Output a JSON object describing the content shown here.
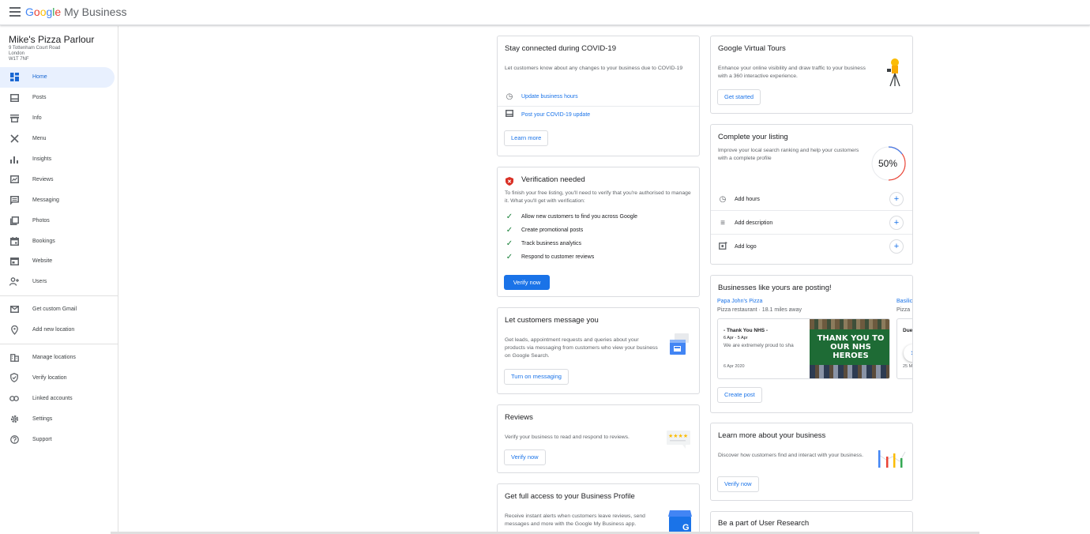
{
  "app": {
    "brand_google": "Google",
    "brand_rest": "My Business"
  },
  "business": {
    "name": "Mike's Pizza Parlour",
    "address": [
      "9 Tottenham Court Road",
      "London",
      "W1T 7NF"
    ]
  },
  "nav": {
    "primary": [
      {
        "label": "Home",
        "icon": "home-icon",
        "active": true
      },
      {
        "label": "Posts",
        "icon": "posts-icon"
      },
      {
        "label": "Info",
        "icon": "store-icon"
      },
      {
        "label": "Menu",
        "icon": "cutlery-icon"
      },
      {
        "label": "Insights",
        "icon": "bar-chart-icon"
      },
      {
        "label": "Reviews",
        "icon": "reviews-icon"
      },
      {
        "label": "Messaging",
        "icon": "messaging-icon"
      },
      {
        "label": "Photos",
        "icon": "photos-icon"
      },
      {
        "label": "Bookings",
        "icon": "calendar-icon"
      },
      {
        "label": "Website",
        "icon": "website-icon"
      },
      {
        "label": "Users",
        "icon": "add-user-icon"
      }
    ],
    "secondary": [
      {
        "label": "Get custom Gmail",
        "icon": "mail-icon"
      },
      {
        "label": "Add new location",
        "icon": "location-pin-icon"
      }
    ],
    "tertiary": [
      {
        "label": "Manage locations",
        "icon": "building-icon"
      },
      {
        "label": "Verify location",
        "icon": "shield-check-icon"
      },
      {
        "label": "Linked accounts",
        "icon": "link-icon"
      },
      {
        "label": "Settings",
        "icon": "gear-icon"
      },
      {
        "label": "Support",
        "icon": "help-icon"
      }
    ]
  },
  "covid": {
    "title": "Stay connected during COVID-19",
    "body": "Let customers know about any changes to your business due to COVID-19",
    "link1": "Update business hours",
    "link2": "Post your COVID-19 update",
    "button": "Learn more"
  },
  "verification": {
    "title": "Verification needed",
    "body": "To finish your free listing, you'll need to verify that you're authorised to manage it. What you'll get with verification:",
    "items": [
      "Allow new customers to find you across Google",
      "Create promotional posts",
      "Track business analytics",
      "Respond to customer reviews"
    ],
    "button": "Verify now"
  },
  "messaging": {
    "title": "Let customers message you",
    "body": "Get leads, appointment requests and queries about your products via messaging from customers who view your business on Google Search.",
    "button": "Turn on messaging"
  },
  "reviews": {
    "title": "Reviews",
    "body": "Verify your business to read and respond to reviews.",
    "button": "Verify now"
  },
  "full_access": {
    "title": "Get full access to your Business Profile",
    "body": "Receive instant alerts when customers leave reviews, send messages and more with the Google My Business app."
  },
  "virtual_tours": {
    "title": "Google Virtual Tours",
    "body": "Enhance your online visibility and draw traffic to your business with a 360 interactive experience.",
    "button": "Get started"
  },
  "listing": {
    "title": "Complete your listing",
    "body": "Improve your local search ranking and help your customers with a complete profile",
    "percent_label": "50%",
    "percent": 50,
    "rows": [
      {
        "label": "Add hours",
        "icon": "clock-icon"
      },
      {
        "label": "Add description",
        "icon": "text-lines-icon"
      },
      {
        "label": "Add logo",
        "icon": "add-photo-icon"
      }
    ]
  },
  "posting": {
    "title": "Businesses like yours are posting!",
    "biz1_name": "Papa John's Pizza",
    "biz1_meta": "Pizza restaurant · 18.1 miles away",
    "biz2_name": "Basilic",
    "biz2_meta": "Pizza",
    "post_title": "- Thank You NHS -",
    "post_dates": "6 Apr - 5 Apr",
    "post_text": "We are extremely proud to sha",
    "post_date": "6 Apr 2020",
    "post_image_text": "THANK YOU TO OUR NHS HEROES",
    "post2_title": "Due",
    "post2_date": "25 M",
    "button": "Create post"
  },
  "learn": {
    "title": "Learn more about your business",
    "body": "Discover how customers find and interact with your business.",
    "button": "Verify now"
  },
  "research": {
    "title": "Be a part of User Research"
  },
  "colors": {
    "accent": "#1a73e8",
    "active_bg": "#e8f0fe",
    "success": "#188038",
    "danger": "#d93025",
    "nhs_green": "#1e6b35"
  }
}
